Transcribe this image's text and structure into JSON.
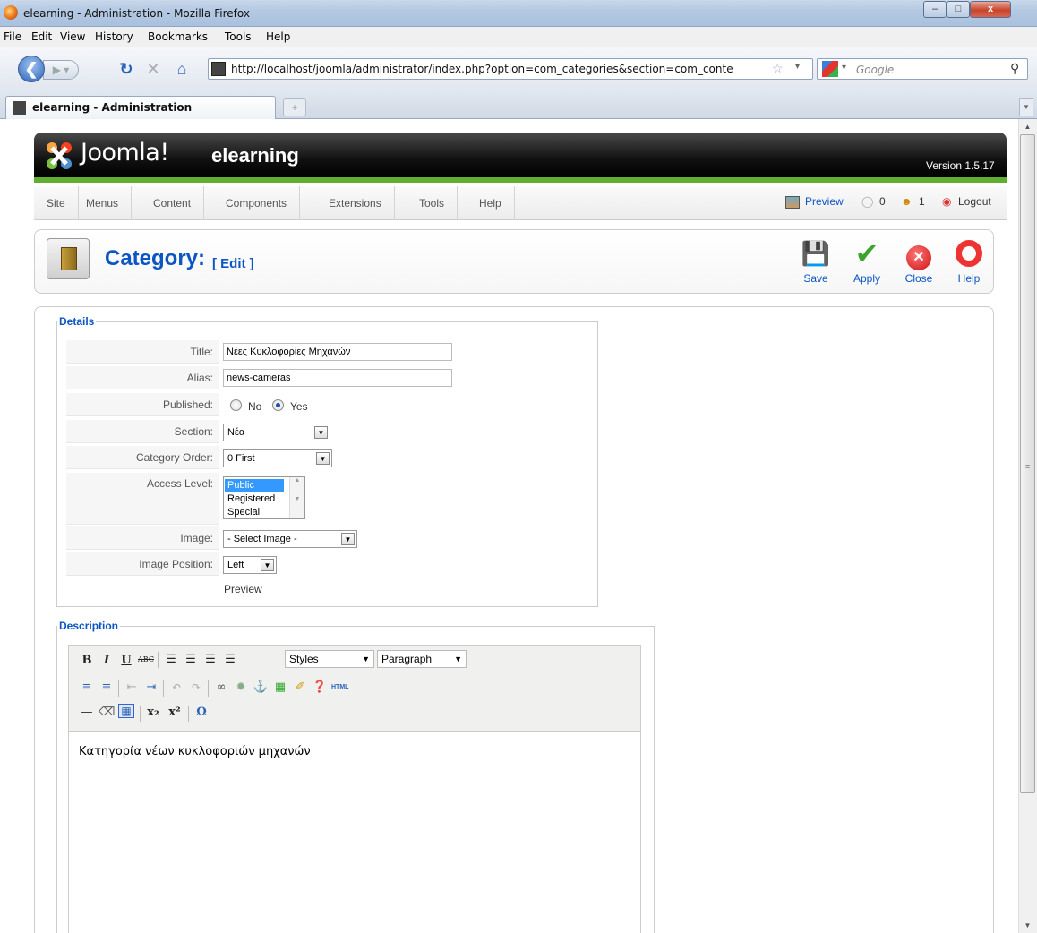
{
  "window": {
    "title": "elearning - Administration - Mozilla Firefox",
    "minimize": "–",
    "maximize": "□",
    "close": "x"
  },
  "menubar": [
    "File",
    "Edit",
    "View",
    "History",
    "Bookmarks",
    "Tools",
    "Help"
  ],
  "nav": {
    "url": "http://localhost/joomla/administrator/index.php?option=com_categories&section=com_conte",
    "search_placeholder": "Google"
  },
  "tab": {
    "label": "elearning - Administration",
    "new_tab": "+"
  },
  "header": {
    "brand": "Joomla!",
    "site_name": "elearning",
    "version": "Version 1.5.17"
  },
  "admin_menu": [
    "Site",
    "Menus",
    "Content",
    "Components",
    "Extensions",
    "Tools",
    "Help"
  ],
  "status": {
    "preview": "Preview",
    "messages": "0",
    "users": "1",
    "logout": "Logout"
  },
  "page": {
    "title": "Category:",
    "subtitle": "[ Edit ]"
  },
  "toolbar": {
    "save": "Save",
    "apply": "Apply",
    "close": "Close",
    "help": "Help"
  },
  "details": {
    "legend": "Details",
    "title_label": "Title:",
    "title_value": "Νέες Κυκλοφορίες Μηχανών",
    "alias_label": "Alias:",
    "alias_value": "news-cameras",
    "published_label": "Published:",
    "published_no": "No",
    "published_yes": "Yes",
    "published_value": "Yes",
    "section_label": "Section:",
    "section_value": "Νέα",
    "order_label": "Category Order:",
    "order_value": "0 First",
    "access_label": "Access Level:",
    "access_options": [
      "Public",
      "Registered",
      "Special"
    ],
    "access_selected": "Public",
    "image_label": "Image:",
    "image_value": "- Select Image -",
    "imgpos_label": "Image Position:",
    "imgpos_value": "Left",
    "preview": "Preview"
  },
  "description": {
    "legend": "Description",
    "styles": "Styles",
    "paragraph": "Paragraph",
    "html_button": "HTML",
    "content": "Κατηγορία νέων κυκλοφοριών μηχανών"
  }
}
